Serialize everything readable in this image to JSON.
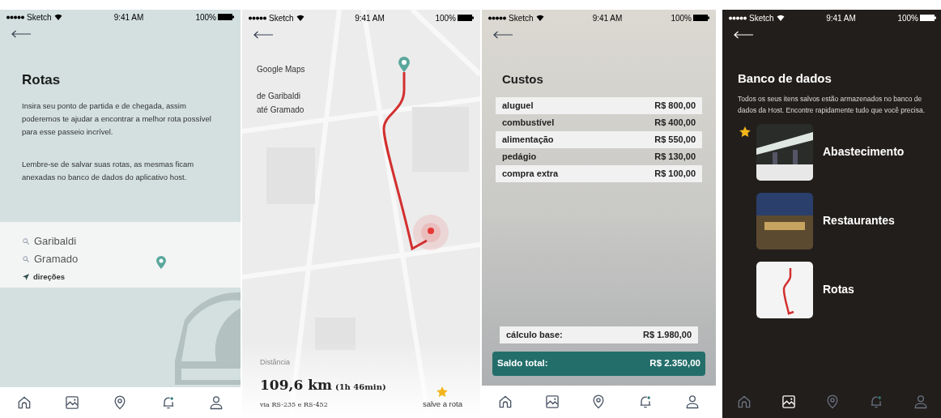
{
  "screens": [
    {
      "kind": "rotas",
      "status": {
        "carrier": "Sketch",
        "time": "9:41 AM",
        "battery": "100%"
      },
      "title": "Rotas",
      "paragraphs": [
        "Insira seu ponto de partida e de chegada, assim poderemos te ajudar a encontrar a melhor rota possível para esse passeio incrível.",
        "Lembre-se de salvar suas rotas, as mesmas ficam anexadas no banco de dados do aplicativo host."
      ],
      "searches": [
        "Garibaldi",
        "Gramado"
      ],
      "directions": "direções",
      "nav": [
        {
          "selected": false
        },
        {
          "selected": false
        },
        {
          "selected": false
        },
        {
          "selected": false
        },
        {
          "selected": false
        }
      ]
    },
    {
      "kind": "map",
      "status": {
        "carrier": "Sketch",
        "time": "9:41 AM",
        "battery": "100%"
      },
      "source": "Google Maps",
      "route_lines": [
        "de Garibaldi",
        "até Gramado"
      ],
      "distance_label": "Distância",
      "distance": "109,6 km",
      "duration": "(1h 46min)",
      "via": "via RS-235 e RS-452",
      "save": "salve a rota"
    },
    {
      "kind": "costs",
      "status": {
        "carrier": "Sketch",
        "time": "9:41 AM",
        "battery": "100%"
      },
      "title": "Custos",
      "rows": [
        {
          "label": "aluguel",
          "value": "R$ 800,00"
        },
        {
          "label": "combustível",
          "value": "R$ 400,00"
        },
        {
          "label": "alimentação",
          "value": "R$ 550,00"
        },
        {
          "label": "pedágio",
          "value": "R$ 130,00"
        },
        {
          "label": "compra extra",
          "value": "R$ 100,00"
        }
      ],
      "base": {
        "label": "cálculo base:",
        "value": "R$ 1.980,00"
      },
      "total": {
        "label": "Saldo total:",
        "value": "R$ 2.350,00"
      },
      "nav": [
        {
          "selected": false
        },
        {
          "selected": false
        },
        {
          "selected": false
        },
        {
          "selected": false
        },
        {
          "selected": false
        }
      ]
    },
    {
      "kind": "database",
      "status": {
        "carrier": "Sketch",
        "time": "9:41 AM",
        "battery": "100%"
      },
      "title": "Banco de dados",
      "paragraph": "Todos os seus itens salvos estão armazenados no banco de dados da Host. Encontre rapidamente tudo que você precisa.",
      "items": [
        {
          "kind": "photo",
          "label": "Abastecimento"
        },
        {
          "kind": "photo",
          "label": "Restaurantes"
        },
        {
          "kind": "route",
          "label": "Rotas"
        }
      ],
      "nav": [
        {
          "selected": false
        },
        {
          "selected": true
        },
        {
          "selected": false
        },
        {
          "selected": false
        },
        {
          "selected": false
        }
      ]
    }
  ]
}
